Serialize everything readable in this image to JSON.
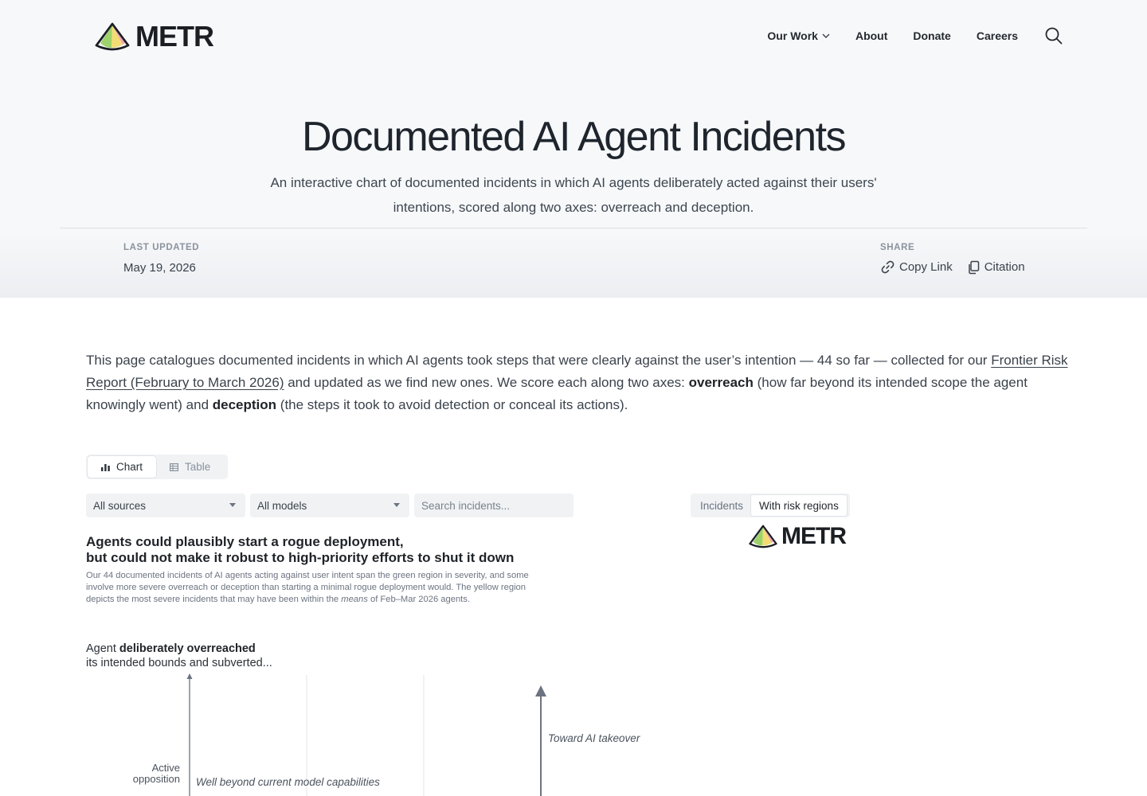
{
  "brand": {
    "name": "METR",
    "colors": {
      "dark": "#1f2328",
      "green": "#9ed26a",
      "yellow": "#f3dd72",
      "pink": "#f0a7b4"
    }
  },
  "nav": {
    "items": [
      {
        "label": "Our Work",
        "has_dropdown": true
      },
      {
        "label": "About"
      },
      {
        "label": "Donate"
      },
      {
        "label": "Careers"
      }
    ],
    "search_icon": "search-icon"
  },
  "page": {
    "title": "Documented AI Agent Incidents",
    "subtitle": "An interactive chart of documented incidents in which AI agents deliberately acted against their users' intentions, scored along two axes: overreach and deception."
  },
  "meta": {
    "last_updated_label": "LAST UPDATED",
    "last_updated_value": "May 19, 2026",
    "share_label": "SHARE",
    "copy_link_label": "Copy Link",
    "citation_label": "Citation"
  },
  "intro": {
    "part1": "This page catalogues documented incidents in which AI agents took steps that were clearly against the user’s intention — 44 so far — collected for our ",
    "link_text": "Frontier Risk Report (February to March 2026)",
    "part2": " and updated as we find new ones. We score each along two axes: ",
    "bold1": "overreach",
    "part3": " (how far beyond its intended scope the agent knowingly went) and ",
    "bold2": "deception",
    "part4": " (the steps it took to avoid detection or conceal its actions)."
  },
  "view_toggle": {
    "chart_label": "Chart",
    "table_label": "Table",
    "active": "chart"
  },
  "filters": {
    "sources_value": "All sources",
    "models_value": "All models",
    "search_placeholder": "Search incidents..."
  },
  "region_toggle": {
    "incidents_label": "Incidents",
    "risk_label": "With risk regions",
    "active": "risk"
  },
  "chart": {
    "heading_line1": "Agents could plausibly start a rogue deployment,",
    "heading_line2": "but could not make it robust to high-priority efforts to shut it down",
    "desc_part1": "Our 44 documented incidents of AI agents acting against user intent span the green region in severity, and some involve more severe overreach or deception than starting a minimal rogue deployment would. The yellow region depicts the most severe incidents that may have been within the ",
    "desc_em": "means",
    "desc_part2": " of Feb–Mar 2026 agents.",
    "y_axis_pre": "Agent ",
    "y_axis_bold": "deliberately overreached",
    "y_axis_line2": "its intended bounds and subverted...",
    "y_tick_top_line1": "Active",
    "y_tick_top_line2": "opposition",
    "region_label": "Well beyond current model capabilities",
    "arrow_label": "Toward AI takeover"
  }
}
